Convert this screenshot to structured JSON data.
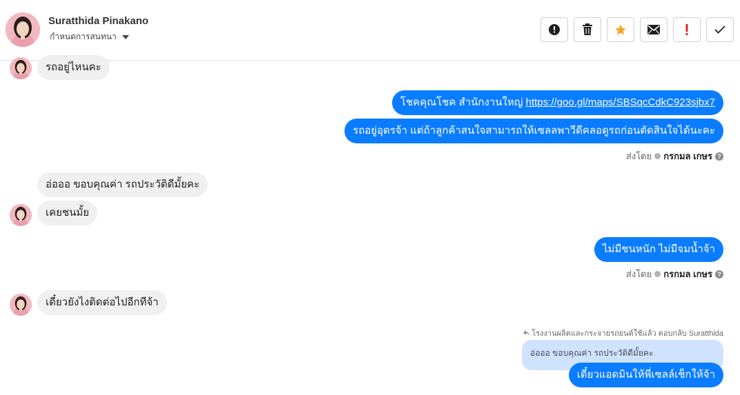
{
  "header": {
    "contact_name": "Suratthida Pinakano",
    "conversation_setting": "กำหนดการสนทนา",
    "toolbar": [
      {
        "name": "report-spam-button",
        "icon": "alert-circle-icon"
      },
      {
        "name": "delete-button",
        "icon": "trash-icon"
      },
      {
        "name": "star-button",
        "icon": "star-icon",
        "color": "#f5a623"
      },
      {
        "name": "mark-unread-button",
        "icon": "envelope-icon"
      },
      {
        "name": "mark-important-button",
        "icon": "exclamation-icon",
        "color": "#e02020"
      },
      {
        "name": "mark-done-button",
        "icon": "check-icon"
      }
    ]
  },
  "messages": {
    "m1": "รถอยู่ไหนคะ",
    "m2_text": "โชคคุณโชค สำนักงานใหญ่ ",
    "m2_link": "https://goo.gl/maps/SBSqcCdkC923sjbx7",
    "m3": "รถอยู่อุดรจ้า แต่ถ้าลูกค้าสนใจสามารถให้เซลลพาวีดีคลอดูรถก่อนตัดสินใจได้นะคะ",
    "m4": "อ่อออ ขอบคุณค่า รถประวัติดีมั้ยคะ",
    "m5": "เคยชนมั้ย",
    "m6": "ไม่มีชนหนัก ไม่มีจมน้ำจ้า",
    "m7": "เดี๋ยวยังไงติดต่อไปอีกทีจ้า",
    "m8": "เดี๋ยวแอดมินให้พี่เซลล์เช็กให้จ้า"
  },
  "sent_by": {
    "label": "ส่งโดย",
    "agent": "กรกมล เกษร"
  },
  "reply": {
    "note": "โรงงานผลิตและกระจายรถยนต์ใช้แล้ว ตอบกลับ Suratthida",
    "quoted_text": "อ่อออ ขอบคุณค่า รถประวัติดีมั้ยคะ"
  },
  "colors": {
    "outgoing": "#0a7cff",
    "incoming": "#f0f0f0",
    "quoted": "#cfe3ff"
  }
}
